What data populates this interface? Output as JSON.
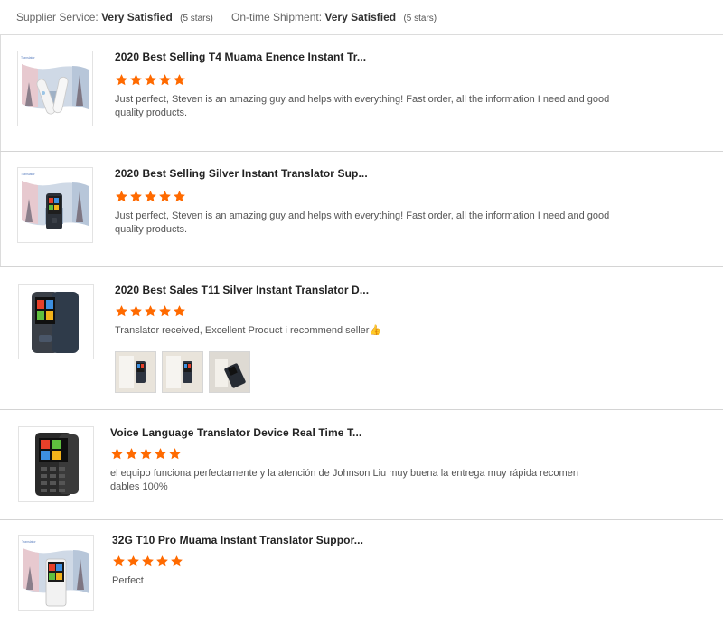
{
  "colors": {
    "star": "#ff6a00",
    "divider": "#d4d4d4"
  },
  "summary": {
    "supplier_service": {
      "label": "Supplier Service:",
      "value": "Very Satisfied",
      "note": "(5 stars)"
    },
    "ontime_shipment": {
      "label": "On-time Shipment:",
      "value": "Very Satisfied",
      "note": "(5 stars)"
    }
  },
  "reviews": [
    {
      "title": "2020 Best Selling T4 Muama Enence Instant Tr...",
      "rating": 5,
      "comment": "Just perfect, Steven is an amazing guy and helps with everything! Fast order, all the information  I need and good quality products.",
      "thumbnail_icon": "translator-t4-product-image"
    },
    {
      "title": "2020 Best Selling Silver Instant Translator Sup...",
      "rating": 5,
      "comment": "Just perfect, Steven is an amazing guy and helps with everything! Fast order, all the information  I need and good quality products.",
      "thumbnail_icon": "translator-silver-product-image"
    },
    {
      "title": "2020 Best Sales T11 Silver Instant Translator D...",
      "rating": 5,
      "comment": "Translator received,  Excellent Product i recommend seller👍",
      "thumbnail_icon": "translator-t11-product-image",
      "photos": [
        "buyer-photo-1",
        "buyer-photo-2",
        "buyer-photo-3"
      ]
    },
    {
      "title": "Voice Language Translator Device Real Time T...",
      "rating": 5,
      "comment": "el equipo funciona perfectamente y la atención de Johnson Liu muy buena la entrega muy rápida recomen dables 100%",
      "thumbnail_icon": "voice-translator-product-image"
    },
    {
      "title": "32G T10 Pro Muama Instant Translator Suppor...",
      "rating": 5,
      "comment": "Perfect",
      "thumbnail_icon": "translator-t10-product-image"
    }
  ]
}
